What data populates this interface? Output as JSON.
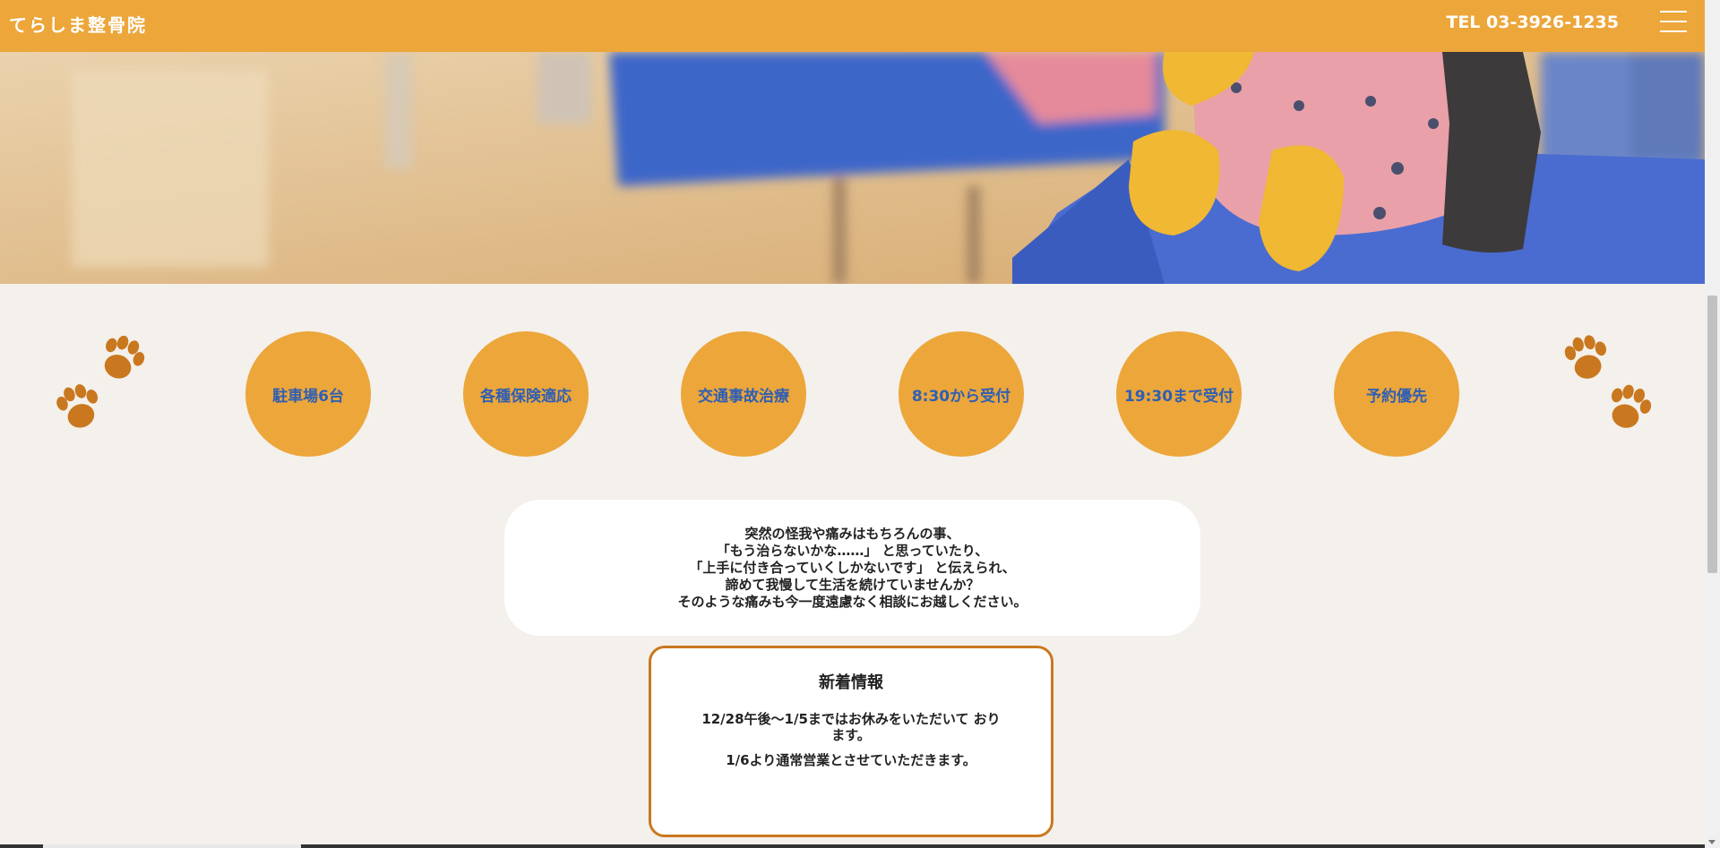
{
  "header": {
    "site_title": "てらしま整骨院",
    "tel": "TEL 03-3926-1235",
    "menu_icon": "hamburger-icon"
  },
  "hero": {
    "image_desc_icon": "photo-icon"
  },
  "features": [
    {
      "label": "駐車場6台"
    },
    {
      "label": "各種保険適応"
    },
    {
      "label": "交通事故治療"
    },
    {
      "label": "8:30から受付"
    },
    {
      "label": "19:30まで受付"
    },
    {
      "label": "予約優先"
    }
  ],
  "intro": {
    "lines": [
      "突然の怪我や痛みはもちろんの事、",
      "「もう治らないかな……」 と思っていたり、",
      "「上手に付き合っていくしかないです」 と伝えられ、",
      "諦めて我慢して生活を続けていませんか？",
      "そのような痛みも今一度遠慮なく相談にお越しください。"
    ]
  },
  "news": {
    "title": "新着情報",
    "line1": "12/28午後〜1/5まではお休みをいただいて おります。",
    "line2": "1/6より通常営業とさせていただきます。"
  },
  "colors": {
    "accent": "#eca63a",
    "feature_text": "#2f5fb3",
    "paw": "#c9781f",
    "news_border": "#c9781f",
    "background": "#f4f0ec"
  }
}
